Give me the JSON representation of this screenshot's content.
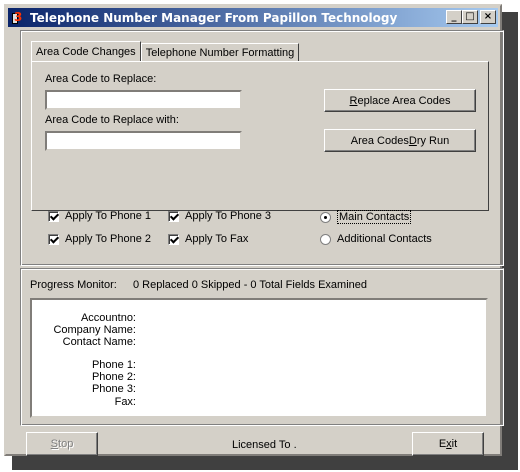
{
  "window": {
    "title": "Telephone Number Manager From Papillon Technology",
    "controls": {
      "minimize": "_",
      "maximize": "□",
      "close": "×"
    }
  },
  "tabs": [
    {
      "label": "Area Code Changes",
      "active": true
    },
    {
      "label": "Telephone Number Formatting",
      "active": false
    }
  ],
  "area_code": {
    "replace_label": "Area Code to Replace:",
    "replace_value": "",
    "replace_with_label": "Area Code to Replace with:",
    "replace_with_value": ""
  },
  "buttons": {
    "replace": {
      "pre": "",
      "accel": "R",
      "post": "eplace Area Codes"
    },
    "dry_run": {
      "pre": "Area Codes ",
      "accel": "D",
      "post": "ry Run"
    },
    "stop": {
      "pre": "",
      "accel": "S",
      "post": "top"
    },
    "exit": {
      "pre": "E",
      "accel": "x",
      "post": "it"
    }
  },
  "options": {
    "apply_phone1": {
      "label": "Apply To Phone 1",
      "checked": true
    },
    "apply_phone2": {
      "label": "Apply To Phone 2",
      "checked": true
    },
    "apply_phone3": {
      "label": "Apply To Phone 3",
      "checked": true
    },
    "apply_fax": {
      "label": "Apply To Fax",
      "checked": true
    },
    "main_contacts": {
      "label": "Main Contacts",
      "selected": true
    },
    "additional_contacts": {
      "label": "Additional Contacts",
      "selected": false
    }
  },
  "progress": {
    "label": "Progress Monitor:",
    "summary": "0 Replaced 0 Skipped - 0 Total Fields Examined"
  },
  "record_fields": {
    "accountno": "Accountno:",
    "company": "Company Name:",
    "contact": "Contact Name:",
    "phone1": "Phone 1:",
    "phone2": "Phone 2:",
    "phone3": "Phone 3:",
    "fax": "Fax:"
  },
  "status": {
    "licensed": "Licensed To ."
  }
}
